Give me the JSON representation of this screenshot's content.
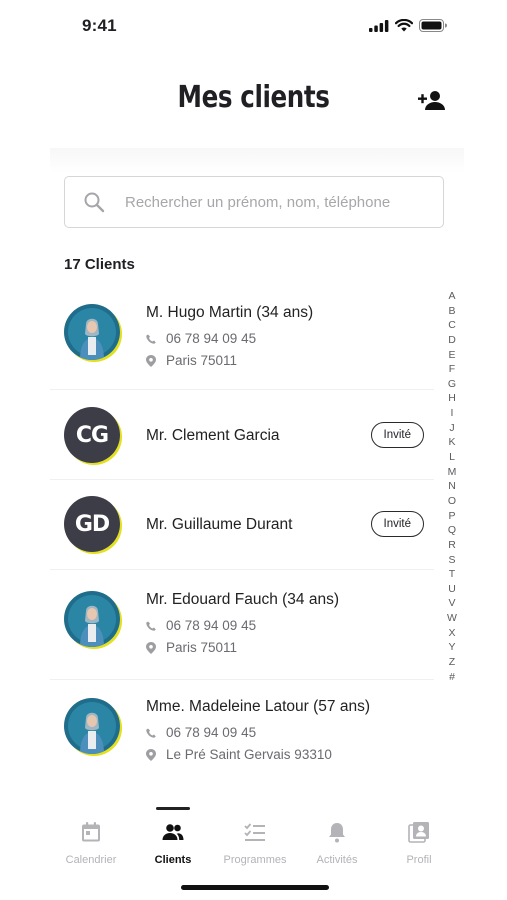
{
  "status_bar": {
    "time": "9:41"
  },
  "header": {
    "title": "Mes clients",
    "add_icon": "add-person-icon"
  },
  "search": {
    "placeholder": "Rechercher un prénom, nom, téléphone",
    "value": ""
  },
  "client_count_label": "17 Clients",
  "clients": [
    {
      "name": "M. Hugo Martin (34 ans)",
      "phone": "06 78 94 09 45",
      "location": "Paris 75011",
      "avatar": "photo"
    },
    {
      "name": "Mr. Clement Garcia",
      "initials": "CG",
      "badge": "Invité",
      "avatar": "initials"
    },
    {
      "name": "Mr. Guillaume Durant",
      "initials": "GD",
      "badge": "Invité",
      "avatar": "initials"
    },
    {
      "name": "Mr. Edouard Fauch (34 ans)",
      "phone": "06 78 94 09 45",
      "location": "Paris 75011",
      "avatar": "photo"
    },
    {
      "name": "Mme. Madeleine Latour (57 ans)",
      "phone": "06 78 94 09 45",
      "location": "Le Pré Saint Gervais 93310",
      "avatar": "photo"
    }
  ],
  "alphabet_index": [
    "A",
    "B",
    "C",
    "D",
    "E",
    "F",
    "G",
    "H",
    "I",
    "J",
    "K",
    "L",
    "M",
    "N",
    "O",
    "P",
    "Q",
    "R",
    "S",
    "T",
    "U",
    "V",
    "W",
    "X",
    "Y",
    "Z",
    "#"
  ],
  "tabs": [
    {
      "label": "Calendrier",
      "icon": "calendar-icon",
      "active": false
    },
    {
      "label": "Clients",
      "icon": "clients-icon",
      "active": true
    },
    {
      "label": "Programmes",
      "icon": "checklist-icon",
      "active": false
    },
    {
      "label": "Activités",
      "icon": "bell-icon",
      "active": false
    },
    {
      "label": "Profil",
      "icon": "profile-icon",
      "active": false
    }
  ],
  "colors": {
    "accent_ring": "#e4e01c",
    "initials_bg": "#3c3d47",
    "text": "#1f1f24",
    "tab_inactive": "#b3b3b8"
  }
}
